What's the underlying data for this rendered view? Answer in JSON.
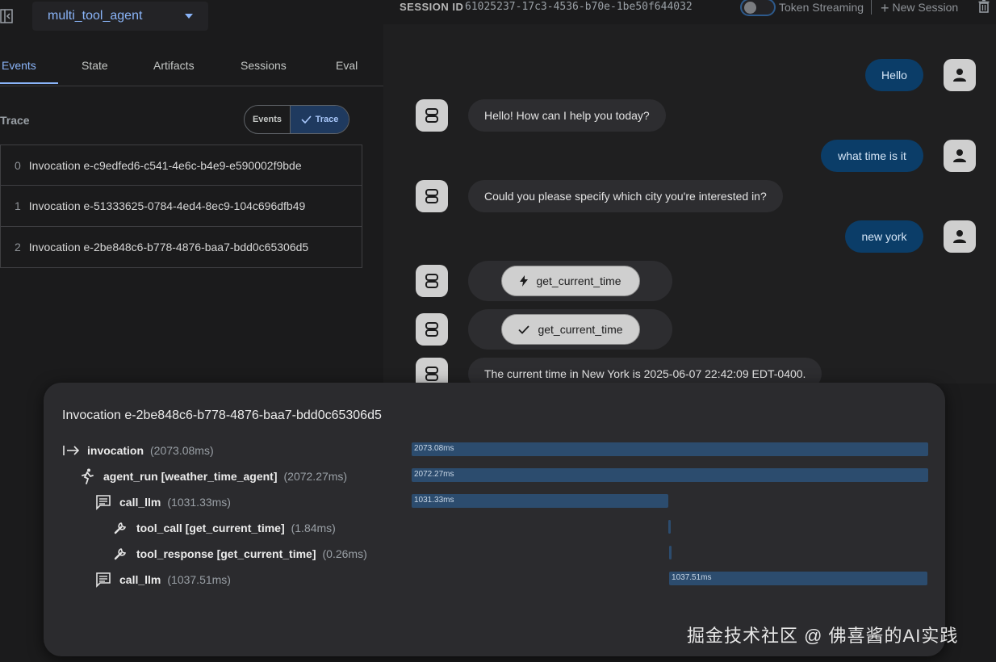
{
  "header": {
    "app_name": "multi_tool_agent",
    "session_label": "SESSION ID",
    "session_id": "61025237-17c3-4536-b70e-1be50f644032",
    "token_streaming_label": "Token Streaming",
    "new_session_label": "New Session"
  },
  "tabs": [
    "Events",
    "State",
    "Artifacts",
    "Sessions",
    "Eval"
  ],
  "trace_panel": {
    "title": "Trace",
    "toggle_events": "Events",
    "toggle_trace": "Trace",
    "invocations": [
      {
        "index": "0",
        "label": "Invocation e-c9edfed6-c541-4e6c-b4e9-e590002f9bde"
      },
      {
        "index": "1",
        "label": "Invocation e-51333625-0784-4ed4-8ec9-104c696dfb49"
      },
      {
        "index": "2",
        "label": "Invocation e-2be848c6-b778-4876-baa7-bdd0c65306d5"
      }
    ]
  },
  "chat": {
    "user_1": "Hello",
    "bot_1": "Hello! How can I help you today?",
    "user_2": "what time is it",
    "bot_2": "Could you please specify which city you're interested in?",
    "user_3": "new york",
    "tool_call": "get_current_time",
    "tool_response": "get_current_time",
    "bot_3": "The current time in New York is 2025-06-07 22:42:09 EDT-0400."
  },
  "modal": {
    "title": "Invocation e-2be848c6-b778-4876-baa7-bdd0c65306d5",
    "total_ms": 2073.08,
    "spans": [
      {
        "name": "invocation",
        "duration": "(2073.08ms)",
        "bar_label": "2073.08ms",
        "icon": "start-arrow-icon",
        "start_ms": 0,
        "duration_ms": 2073.08
      },
      {
        "name": "agent_run [weather_time_agent]",
        "duration": "(2072.27ms)",
        "bar_label": "2072.27ms",
        "icon": "running-person-icon",
        "start_ms": 0,
        "duration_ms": 2072.27
      },
      {
        "name": "call_llm",
        "duration": "(1031.33ms)",
        "bar_label": "1031.33ms",
        "icon": "chat-icon",
        "start_ms": 0,
        "duration_ms": 1031.33
      },
      {
        "name": "tool_call [get_current_time]",
        "duration": "(1.84ms)",
        "bar_label": "",
        "icon": "wrench-icon",
        "start_ms": 1031.33,
        "duration_ms": 1.84
      },
      {
        "name": "tool_response [get_current_time]",
        "duration": "(0.26ms)",
        "bar_label": "",
        "icon": "wrench-icon",
        "start_ms": 1033.17,
        "duration_ms": 0.26
      },
      {
        "name": "call_llm",
        "duration": "(1037.51ms)",
        "bar_label": "1037.51ms",
        "icon": "chat-icon",
        "start_ms": 1033.43,
        "duration_ms": 1037.51
      }
    ]
  },
  "watermark": "掘金技术社区 @ 佛喜酱的AI实践",
  "colors": {
    "accent": "#8ab4f8",
    "user_bubble": "#0b3d68",
    "bar": "#2c4c6e"
  }
}
